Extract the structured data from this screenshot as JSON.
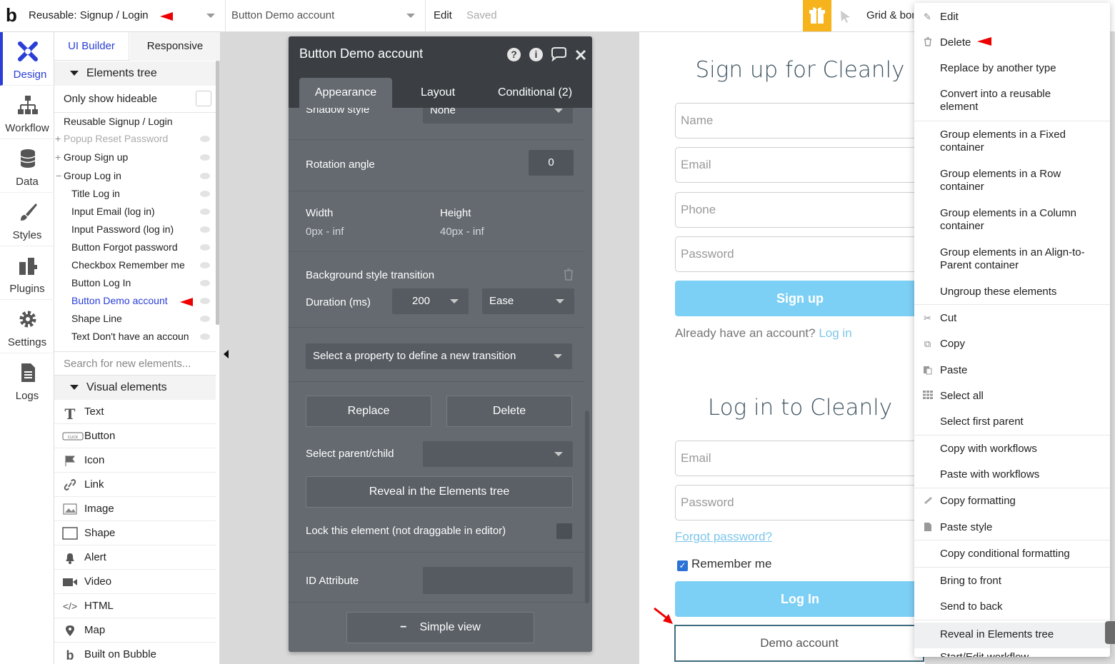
{
  "topbar": {
    "page_select": "Reusable: Signup / Login",
    "element_select": "Button Demo account",
    "edit": "Edit",
    "saved": "Saved",
    "grid": "Grid & borders"
  },
  "nav": {
    "design": "Design",
    "workflow": "Workflow",
    "data": "Data",
    "styles": "Styles",
    "plugins": "Plugins",
    "settings": "Settings",
    "logs": "Logs"
  },
  "panel": {
    "tab_ui": "UI Builder",
    "tab_responsive": "Responsive",
    "elements_tree": "Elements tree",
    "only_hideable": "Only show hideable",
    "tree": [
      "Reusable Signup / Login",
      "Popup Reset Password",
      "Group Sign up",
      "Group Log in",
      "Title Log in",
      "Input Email (log in)",
      "Input Password (log in)",
      "Button Forgot password",
      "Checkbox Remember me",
      "Button Log In",
      "Button Demo account",
      "Shape Line",
      "Text Don't have an accoun"
    ],
    "search_placeholder": "Search for new elements...",
    "visual_elements": "Visual elements",
    "visual": [
      "Text",
      "Button",
      "Icon",
      "Link",
      "Image",
      "Shape",
      "Alert",
      "Video",
      "HTML",
      "Map",
      "Built on Bubble"
    ]
  },
  "prop": {
    "title": "Button Demo account",
    "tab_appearance": "Appearance",
    "tab_layout": "Layout",
    "tab_conditional": "Conditional (2)",
    "shadow_label": "Shadow style",
    "shadow_value": "None",
    "rotation_label": "Rotation angle",
    "rotation_value": "0",
    "width_label": "Width",
    "width_value": "0px - inf",
    "height_label": "Height",
    "height_value": "40px - inf",
    "bg_transition": "Background style transition",
    "duration_label": "Duration (ms)",
    "duration_value": "200",
    "easing_value": "Ease",
    "new_transition": "Select a property to define a new transition",
    "replace": "Replace",
    "delete": "Delete",
    "parent_child": "Select parent/child",
    "reveal": "Reveal in the Elements tree",
    "lock": "Lock this element (not draggable in editor)",
    "id_attr": "ID Attribute",
    "simple_view": "Simple view"
  },
  "page": {
    "signup_title": "Sign up for Cleanly",
    "name_ph": "Name",
    "email_ph": "Email",
    "phone_ph": "Phone",
    "password_ph": "Password",
    "signup_btn": "Sign up",
    "already": "Already have an account?",
    "login_link": "Log in",
    "login_title": "Log in to Cleanly",
    "login_email_ph": "Email",
    "login_password_ph": "Password",
    "forgot": "Forgot password?",
    "remember": "Remember me",
    "login_btn": "Log In",
    "demo_btn": "Demo account"
  },
  "menu": {
    "edit": "Edit",
    "delete": "Delete",
    "replace_type": "Replace by another type",
    "convert_1": "Convert into a reusable",
    "convert_2": "element",
    "fixed_1": "Group elements in a Fixed",
    "fixed_2": "container",
    "row_1": "Group elements in a Row",
    "row_2": "container",
    "col_1": "Group elements in a Column",
    "col_2": "container",
    "align_1": "Group elements in an Align-to-",
    "align_2": "Parent container",
    "ungroup": "Ungroup these elements",
    "cut": "Cut",
    "copy": "Copy",
    "paste": "Paste",
    "select_all": "Select all",
    "select_parent": "Select first parent",
    "copy_wf": "Copy with workflows",
    "paste_wf": "Paste with workflows",
    "copy_fmt": "Copy formatting",
    "paste_style": "Paste style",
    "copy_cond": "Copy conditional formatting",
    "front": "Bring to front",
    "back": "Send to back",
    "reveal": "Reveal in Elements tree",
    "start_edit": "Start/Edit workflow"
  },
  "colors": {
    "accent": "#2a3ed6",
    "button_blue": "#7dd0f5",
    "gift": "#f6b31b",
    "panel_dark": "#3b3f43",
    "panel": "#646a70"
  }
}
